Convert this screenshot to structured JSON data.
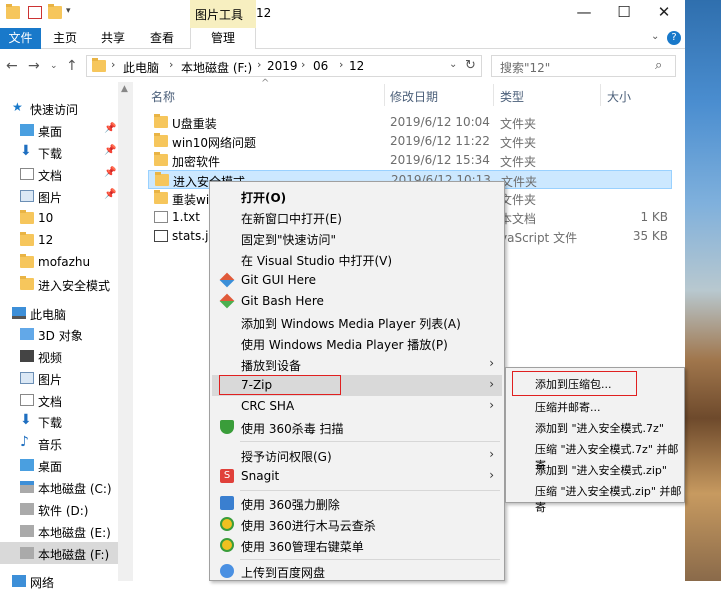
{
  "titlebar": {
    "context_tab": "图片工具",
    "window_title": "12",
    "minimize": "—",
    "maximize": "☐",
    "close": "✕"
  },
  "ribbon": {
    "tabs": [
      "文件",
      "主页",
      "共享",
      "查看",
      "管理"
    ],
    "collapse_icon": "chevron-down-icon",
    "help_icon": "?"
  },
  "address": {
    "breadcrumbs": [
      "此电脑",
      "本地磁盘 (F:)",
      "2019",
      "06",
      "12"
    ],
    "search_placeholder": "搜索\"12\""
  },
  "nav": {
    "items": [
      {
        "label": "快速访问",
        "icon": "star-icon",
        "pinned": false
      },
      {
        "label": "桌面",
        "icon": "desktop-icon",
        "pinned": true
      },
      {
        "label": "下载",
        "icon": "download-icon",
        "pinned": true
      },
      {
        "label": "文档",
        "icon": "document-icon",
        "pinned": true
      },
      {
        "label": "图片",
        "icon": "picture-icon",
        "pinned": true
      },
      {
        "label": "10",
        "icon": "folder-icon",
        "pinned": false
      },
      {
        "label": "12",
        "icon": "folder-icon",
        "pinned": false
      },
      {
        "label": "mofazhu",
        "icon": "folder-icon",
        "pinned": false
      },
      {
        "label": "进入安全模式",
        "icon": "folder-icon",
        "pinned": false
      },
      {
        "label": "此电脑",
        "icon": "computer-icon",
        "pinned": false
      },
      {
        "label": "3D 对象",
        "icon": "cube-icon",
        "pinned": false
      },
      {
        "label": "视频",
        "icon": "video-icon",
        "pinned": false
      },
      {
        "label": "图片",
        "icon": "picture-icon",
        "pinned": false
      },
      {
        "label": "文档",
        "icon": "document-icon",
        "pinned": false
      },
      {
        "label": "下载",
        "icon": "download-icon",
        "pinned": false
      },
      {
        "label": "音乐",
        "icon": "music-icon",
        "pinned": false
      },
      {
        "label": "桌面",
        "icon": "desktop-icon",
        "pinned": false
      },
      {
        "label": "本地磁盘 (C:)",
        "icon": "drive-icon",
        "pinned": false
      },
      {
        "label": "软件 (D:)",
        "icon": "drive-icon",
        "pinned": false
      },
      {
        "label": "本地磁盘 (E:)",
        "icon": "drive-icon",
        "pinned": false
      },
      {
        "label": "本地磁盘 (F:)",
        "icon": "drive-icon",
        "pinned": false
      },
      {
        "label": "网络",
        "icon": "network-icon",
        "pinned": false
      }
    ]
  },
  "files": {
    "columns": [
      "名称",
      "修改日期",
      "类型",
      "大小"
    ],
    "rows": [
      {
        "name": "U盘重装",
        "date": "2019/6/12 10:04",
        "type": "文件夹",
        "size": ""
      },
      {
        "name": "win10网络问题",
        "date": "2019/6/12 11:22",
        "type": "文件夹",
        "size": ""
      },
      {
        "name": "加密软件",
        "date": "2019/6/12 15:34",
        "type": "文件夹",
        "size": ""
      },
      {
        "name": "进入安全模式",
        "date": "2019/6/12 10:13",
        "type": "文件夹",
        "size": ""
      },
      {
        "name": "重装win",
        "date": "",
        "type": "文件夹",
        "size": ""
      },
      {
        "name": "1.txt",
        "date": "",
        "type": "本文档",
        "size": "1 KB"
      },
      {
        "name": "stats.js",
        "date": "",
        "type": "vaScript 文件",
        "size": "35 KB"
      }
    ]
  },
  "context_menu": {
    "items": [
      {
        "label": "打开(O)",
        "icon": "",
        "bold": true,
        "arrow": false
      },
      {
        "label": "在新窗口中打开(E)",
        "icon": "",
        "arrow": false
      },
      {
        "label": "固定到\"快速访问\"",
        "icon": "",
        "arrow": false
      },
      {
        "label": "在 Visual Studio 中打开(V)",
        "icon": "",
        "arrow": false
      },
      {
        "label": "Git GUI Here",
        "icon": "git-icon",
        "arrow": false
      },
      {
        "label": "Git Bash Here",
        "icon": "git-icon",
        "arrow": false
      },
      {
        "label": "添加到 Windows Media Player 列表(A)",
        "icon": "",
        "arrow": false
      },
      {
        "label": "使用 Windows Media Player 播放(P)",
        "icon": "",
        "arrow": false
      },
      {
        "label": "播放到设备",
        "icon": "",
        "arrow": true
      },
      {
        "label": "7-Zip",
        "icon": "",
        "arrow": true
      },
      {
        "label": "CRC SHA",
        "icon": "",
        "arrow": true
      },
      {
        "label": "使用 360杀毒 扫描",
        "icon": "shield-icon",
        "arrow": false
      },
      {
        "label": "授予访问权限(G)",
        "icon": "",
        "arrow": true
      },
      {
        "label": "Snagit",
        "icon": "snagit-icon",
        "arrow": true
      },
      {
        "label": "使用 360强力删除",
        "icon": "trash-icon",
        "arrow": false
      },
      {
        "label": "使用 360进行木马云查杀",
        "icon": "shield-360-icon",
        "arrow": false
      },
      {
        "label": "使用 360管理右键菜单",
        "icon": "shield-360-icon",
        "arrow": false
      },
      {
        "label": "上传到百度网盘",
        "icon": "cloud-icon",
        "arrow": false
      }
    ]
  },
  "submenu_7zip": {
    "items": [
      "添加到压缩包...",
      "压缩并邮寄...",
      "添加到 \"进入安全模式.7z\"",
      "压缩 \"进入安全模式.7z\" 并邮寄",
      "添加到 \"进入安全模式.zip\"",
      "压缩 \"进入安全模式.zip\" 并邮寄"
    ]
  },
  "colors": {
    "file_tab": "#1979ca",
    "selection": "#cce8ff",
    "highlight_box": "#e02020",
    "folder": "#f6c65c"
  }
}
